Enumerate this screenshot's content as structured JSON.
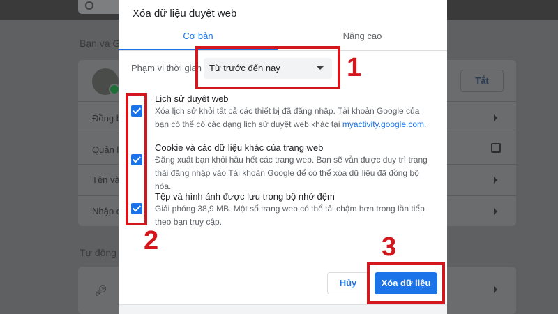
{
  "background": {
    "section_you_and_google": "Bạn và Go",
    "section_autofill": "Tự động đ",
    "rows": [
      "Đồng b",
      "Quản lý",
      "Tên và",
      "Nhập d"
    ],
    "turn_off_label": "Tắt"
  },
  "dialog": {
    "title": "Xóa dữ liệu duyệt web",
    "tabs": [
      {
        "label": "Cơ bản",
        "active": true
      },
      {
        "label": "Nâng cao",
        "active": false
      }
    ],
    "time_range": {
      "label": "Phạm vi thời gian",
      "value": "Từ trước đến nay"
    },
    "options": [
      {
        "title": "Lịch sử duyệt web",
        "desc": "Xóa lịch sử khỏi tất cả các thiết bị đã đăng nhập. Tài khoản Google của bạn có thể có các dạng lịch sử duyệt web khác tại ",
        "link": "myactivity.google.com",
        "desc_end": ".",
        "checked": true
      },
      {
        "title": "Cookie và các dữ liệu khác của trang web",
        "desc": "Đăng xuất bạn khỏi hầu hết các trang web. Bạn sẽ vẫn được duy trì trạng thái đăng nhập vào Tài khoản Google để có thể xóa dữ liệu đã đồng bộ hóa.",
        "checked": true
      },
      {
        "title": "Tệp và hình ảnh được lưu trong bộ nhớ đệm",
        "desc": "Giải phóng 38,9 MB. Một số trang web có thể tải chậm hơn trong lần tiếp theo bạn truy cập.",
        "checked": true
      }
    ],
    "cancel_label": "Hủy",
    "clear_label": "Xóa dữ liệu"
  },
  "annotations": {
    "step1": "1",
    "step2": "2",
    "step3": "3",
    "color": "#d4171c"
  },
  "colors": {
    "accent": "#1a73e8",
    "overlay": "#5f6061"
  }
}
